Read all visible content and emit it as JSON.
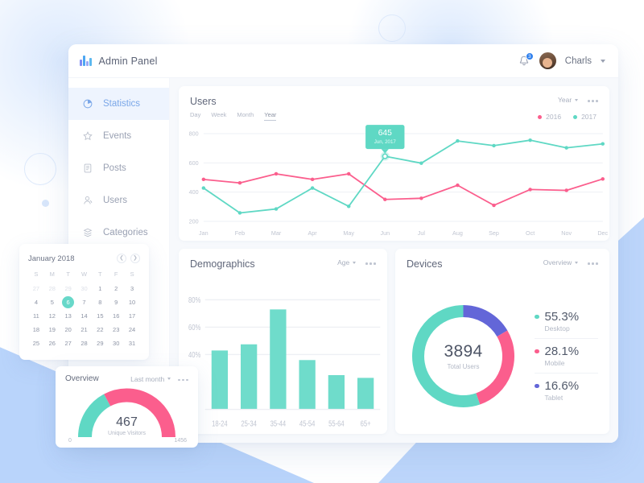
{
  "theme": {
    "teal": "#5fd8c4",
    "pink": "#fb5e8d",
    "purple": "#6366d8",
    "blue_accent": "#7aa7e8",
    "page_bg": "#ffffff",
    "panel_bg": "#f7f9fc"
  },
  "topbar": {
    "brand_title": "Admin Panel",
    "notification_count": "3",
    "user_name": "Charls"
  },
  "sidebar": {
    "items": [
      {
        "label": "Statistics",
        "icon": "pie-chart-icon",
        "active": true
      },
      {
        "label": "Events",
        "icon": "star-icon",
        "active": false
      },
      {
        "label": "Posts",
        "icon": "document-icon",
        "active": false
      },
      {
        "label": "Users",
        "icon": "user-icon",
        "active": false
      },
      {
        "label": "Categories",
        "icon": "layers-icon",
        "active": false
      }
    ]
  },
  "users_card": {
    "title": "Users",
    "range_tabs": [
      "Day",
      "Week",
      "Month",
      "Year"
    ],
    "active_range": "Year",
    "period_select": "Year",
    "legend": [
      {
        "label": "2016",
        "color": "#fb5e8d"
      },
      {
        "label": "2017",
        "color": "#5fd8c4"
      }
    ],
    "tooltip": {
      "value": "645",
      "caption": "Jun, 2017"
    }
  },
  "demographics_card": {
    "title": "Demographics",
    "select": "Age"
  },
  "devices_card": {
    "title": "Devices",
    "select": "Overview",
    "center_value": "3894",
    "center_label": "Total Users",
    "items": [
      {
        "pct": "55.3%",
        "name": "Desktop",
        "color": "#5fd8c4",
        "value": 55.3
      },
      {
        "pct": "28.1%",
        "name": "Mobile",
        "color": "#fb5e8d",
        "value": 28.1
      },
      {
        "pct": "16.6%",
        "name": "Tablet",
        "color": "#6366d8",
        "value": 16.6
      }
    ]
  },
  "calendar": {
    "month_label": "January 2018",
    "prev_icon": "chevron-left-icon",
    "next_icon": "chevron-right-icon",
    "dow": [
      "S",
      "M",
      "T",
      "W",
      "T",
      "F",
      "S"
    ],
    "weeks": [
      [
        {
          "d": "27",
          "muted": true
        },
        {
          "d": "28",
          "muted": true
        },
        {
          "d": "29",
          "muted": true
        },
        {
          "d": "30",
          "muted": true
        },
        {
          "d": "1"
        },
        {
          "d": "2"
        },
        {
          "d": "3"
        }
      ],
      [
        {
          "d": "4"
        },
        {
          "d": "5"
        },
        {
          "d": "6",
          "selected": true
        },
        {
          "d": "7"
        },
        {
          "d": "8"
        },
        {
          "d": "9"
        },
        {
          "d": "10"
        }
      ],
      [
        {
          "d": "11"
        },
        {
          "d": "12"
        },
        {
          "d": "13"
        },
        {
          "d": "14"
        },
        {
          "d": "15"
        },
        {
          "d": "16"
        },
        {
          "d": "17"
        }
      ],
      [
        {
          "d": "18"
        },
        {
          "d": "19"
        },
        {
          "d": "20"
        },
        {
          "d": "21"
        },
        {
          "d": "22"
        },
        {
          "d": "23"
        },
        {
          "d": "24"
        }
      ],
      [
        {
          "d": "25"
        },
        {
          "d": "26"
        },
        {
          "d": "27"
        },
        {
          "d": "28"
        },
        {
          "d": "29"
        },
        {
          "d": "30"
        },
        {
          "d": "31"
        }
      ]
    ]
  },
  "overview_widget": {
    "title": "Overview",
    "select": "Last month",
    "value": "467",
    "sub_label": "Unique Visitors",
    "min": "0",
    "max": "1456"
  },
  "chart_data": [
    {
      "type": "line",
      "title": "Users",
      "xlabel": "",
      "ylabel": "",
      "categories": [
        "Jan",
        "Feb",
        "Mar",
        "Apr",
        "May",
        "Jun",
        "Jul",
        "Aug",
        "Sep",
        "Oct",
        "Nov",
        "Dec"
      ],
      "yticks": [
        200,
        400,
        600,
        800
      ],
      "ylim": [
        200,
        800
      ],
      "grid": true,
      "legend_position": "top-right",
      "series": [
        {
          "name": "2016",
          "color": "#fb5e8d",
          "values": [
            487,
            463,
            525,
            487,
            525,
            350,
            358,
            447,
            310,
            418,
            412,
            490
          ]
        },
        {
          "name": "2017",
          "color": "#5fd8c4",
          "values": [
            428,
            258,
            285,
            428,
            303,
            645,
            598,
            750,
            718,
            755,
            703,
            730
          ]
        }
      ],
      "annotation": {
        "label": "645",
        "caption": "Jun, 2017",
        "at_category": "Jun",
        "series": "2017"
      }
    },
    {
      "type": "bar",
      "title": "Demographics",
      "xlabel": "",
      "ylabel": "",
      "categories": [
        "18-24",
        "25-34",
        "35-44",
        "45-54",
        "55-64",
        "65+"
      ],
      "values": [
        43,
        47.5,
        73,
        36,
        25,
        23
      ],
      "ytick_labels": [
        "40%",
        "60%",
        "80%"
      ],
      "yticks": [
        40,
        60,
        80
      ],
      "ylim": [
        0,
        88
      ],
      "grid": true,
      "color": "#6fdccb"
    },
    {
      "type": "pie",
      "title": "Devices",
      "labels": [
        "Tablet",
        "Mobile",
        "Desktop"
      ],
      "values": [
        16.6,
        28.1,
        55.3
      ],
      "colors": [
        "#6366d8",
        "#fb5e8d",
        "#5fd8c4"
      ],
      "center_text": "3894",
      "center_subtext": "Total Users",
      "legend_position": "right"
    },
    {
      "type": "gauge",
      "title": "Overview",
      "value": 467,
      "min": 0,
      "max": 1456,
      "label": "Unique Visitors",
      "fill_color": "#fb5e8d",
      "track_color": "#5fd8c4"
    }
  ]
}
